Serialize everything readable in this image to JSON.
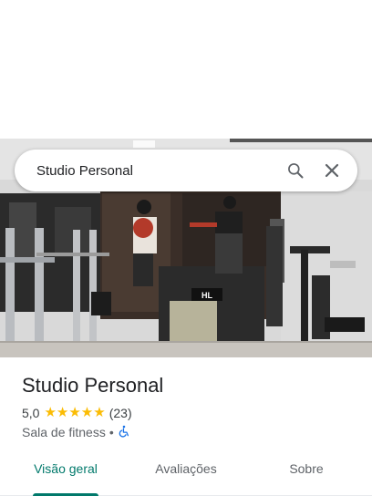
{
  "search": {
    "query": "Studio Personal"
  },
  "place": {
    "name": "Studio Personal",
    "rating": "5,0",
    "stars": "★★★★★",
    "review_count": "(23)",
    "category": "Sala de fitness",
    "separator": "•"
  },
  "tabs": [
    {
      "label": "Visão geral",
      "active": true
    },
    {
      "label": "Avaliações",
      "active": false
    },
    {
      "label": "Sobre",
      "active": false
    }
  ],
  "colors": {
    "accent": "#00796b",
    "star": "#fbbc04",
    "accessibility": "#1a73e8"
  },
  "icons": [
    "search-icon",
    "close-icon",
    "wheelchair-accessible-icon"
  ],
  "photo": {
    "machine_badge": "HL"
  }
}
